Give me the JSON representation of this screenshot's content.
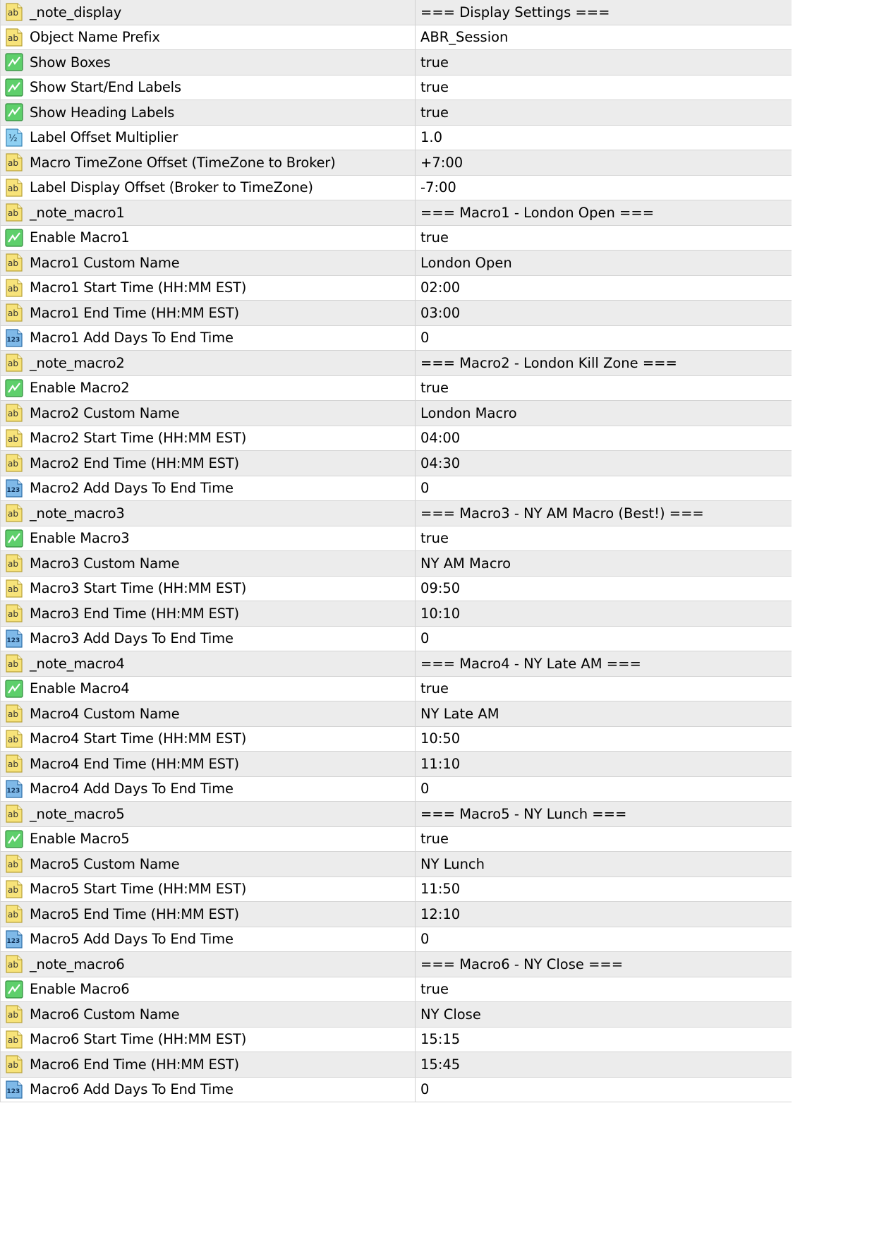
{
  "rows": [
    {
      "type": "string",
      "name": "_note_display",
      "value": "=== Display Settings ==="
    },
    {
      "type": "string",
      "name": "Object Name Prefix",
      "value": "ABR_Session"
    },
    {
      "type": "bool",
      "name": "Show Boxes",
      "value": "true"
    },
    {
      "type": "bool",
      "name": "Show Start/End Labels",
      "value": "true"
    },
    {
      "type": "bool",
      "name": "Show Heading Labels",
      "value": "true"
    },
    {
      "type": "double",
      "name": "Label Offset Multiplier",
      "value": "1.0"
    },
    {
      "type": "string",
      "name": "Macro TimeZone Offset (TimeZone to Broker)",
      "value": "+7:00"
    },
    {
      "type": "string",
      "name": "Label Display Offset (Broker to TimeZone)",
      "value": "-7:00"
    },
    {
      "type": "string",
      "name": "_note_macro1",
      "value": "=== Macro1 - London Open ==="
    },
    {
      "type": "bool",
      "name": "Enable Macro1",
      "value": "true"
    },
    {
      "type": "string",
      "name": "Macro1 Custom Name",
      "value": "London Open"
    },
    {
      "type": "string",
      "name": "Macro1 Start Time (HH:MM EST)",
      "value": "02:00"
    },
    {
      "type": "string",
      "name": "Macro1 End Time (HH:MM EST)",
      "value": "03:00"
    },
    {
      "type": "int",
      "name": "Macro1 Add Days To End Time",
      "value": "0"
    },
    {
      "type": "string",
      "name": "_note_macro2",
      "value": "=== Macro2 - London Kill Zone ==="
    },
    {
      "type": "bool",
      "name": "Enable Macro2",
      "value": "true"
    },
    {
      "type": "string",
      "name": "Macro2 Custom Name",
      "value": "London Macro"
    },
    {
      "type": "string",
      "name": "Macro2 Start Time (HH:MM EST)",
      "value": "04:00"
    },
    {
      "type": "string",
      "name": "Macro2 End Time (HH:MM EST)",
      "value": "04:30"
    },
    {
      "type": "int",
      "name": "Macro2 Add Days To End Time",
      "value": "0"
    },
    {
      "type": "string",
      "name": "_note_macro3",
      "value": "=== Macro3 - NY AM Macro (Best!) ==="
    },
    {
      "type": "bool",
      "name": "Enable Macro3",
      "value": "true"
    },
    {
      "type": "string",
      "name": "Macro3 Custom Name",
      "value": "NY AM Macro"
    },
    {
      "type": "string",
      "name": "Macro3 Start Time (HH:MM EST)",
      "value": "09:50"
    },
    {
      "type": "string",
      "name": "Macro3 End Time (HH:MM EST)",
      "value": "10:10"
    },
    {
      "type": "int",
      "name": "Macro3 Add Days To End Time",
      "value": "0"
    },
    {
      "type": "string",
      "name": "_note_macro4",
      "value": "=== Macro4 - NY Late AM ==="
    },
    {
      "type": "bool",
      "name": "Enable Macro4",
      "value": "true"
    },
    {
      "type": "string",
      "name": "Macro4 Custom Name",
      "value": "NY Late AM"
    },
    {
      "type": "string",
      "name": "Macro4 Start Time (HH:MM EST)",
      "value": "10:50"
    },
    {
      "type": "string",
      "name": "Macro4 End Time (HH:MM EST)",
      "value": "11:10"
    },
    {
      "type": "int",
      "name": "Macro4 Add Days To End Time",
      "value": "0"
    },
    {
      "type": "string",
      "name": "_note_macro5",
      "value": "=== Macro5 - NY Lunch ==="
    },
    {
      "type": "bool",
      "name": "Enable Macro5",
      "value": "true"
    },
    {
      "type": "string",
      "name": "Macro5 Custom Name",
      "value": "NY Lunch"
    },
    {
      "type": "string",
      "name": "Macro5 Start Time (HH:MM EST)",
      "value": "11:50"
    },
    {
      "type": "string",
      "name": "Macro5 End Time (HH:MM EST)",
      "value": "12:10"
    },
    {
      "type": "int",
      "name": "Macro5 Add Days To End Time",
      "value": "0"
    },
    {
      "type": "string",
      "name": "_note_macro6",
      "value": "=== Macro6 - NY Close ==="
    },
    {
      "type": "bool",
      "name": "Enable Macro6",
      "value": "true"
    },
    {
      "type": "string",
      "name": "Macro6 Custom Name",
      "value": "NY Close"
    },
    {
      "type": "string",
      "name": "Macro6 Start Time (HH:MM EST)",
      "value": "15:15"
    },
    {
      "type": "string",
      "name": "Macro6 End Time (HH:MM EST)",
      "value": "15:45"
    },
    {
      "type": "int",
      "name": "Macro6 Add Days To End Time",
      "value": "0"
    }
  ],
  "icons": {
    "string": "string-ab-icon",
    "bool": "bool-toggle-icon",
    "double": "double-half-icon",
    "int": "int-123-icon"
  },
  "icon_text": {
    "string": "ab",
    "double": "½",
    "int": "123"
  }
}
